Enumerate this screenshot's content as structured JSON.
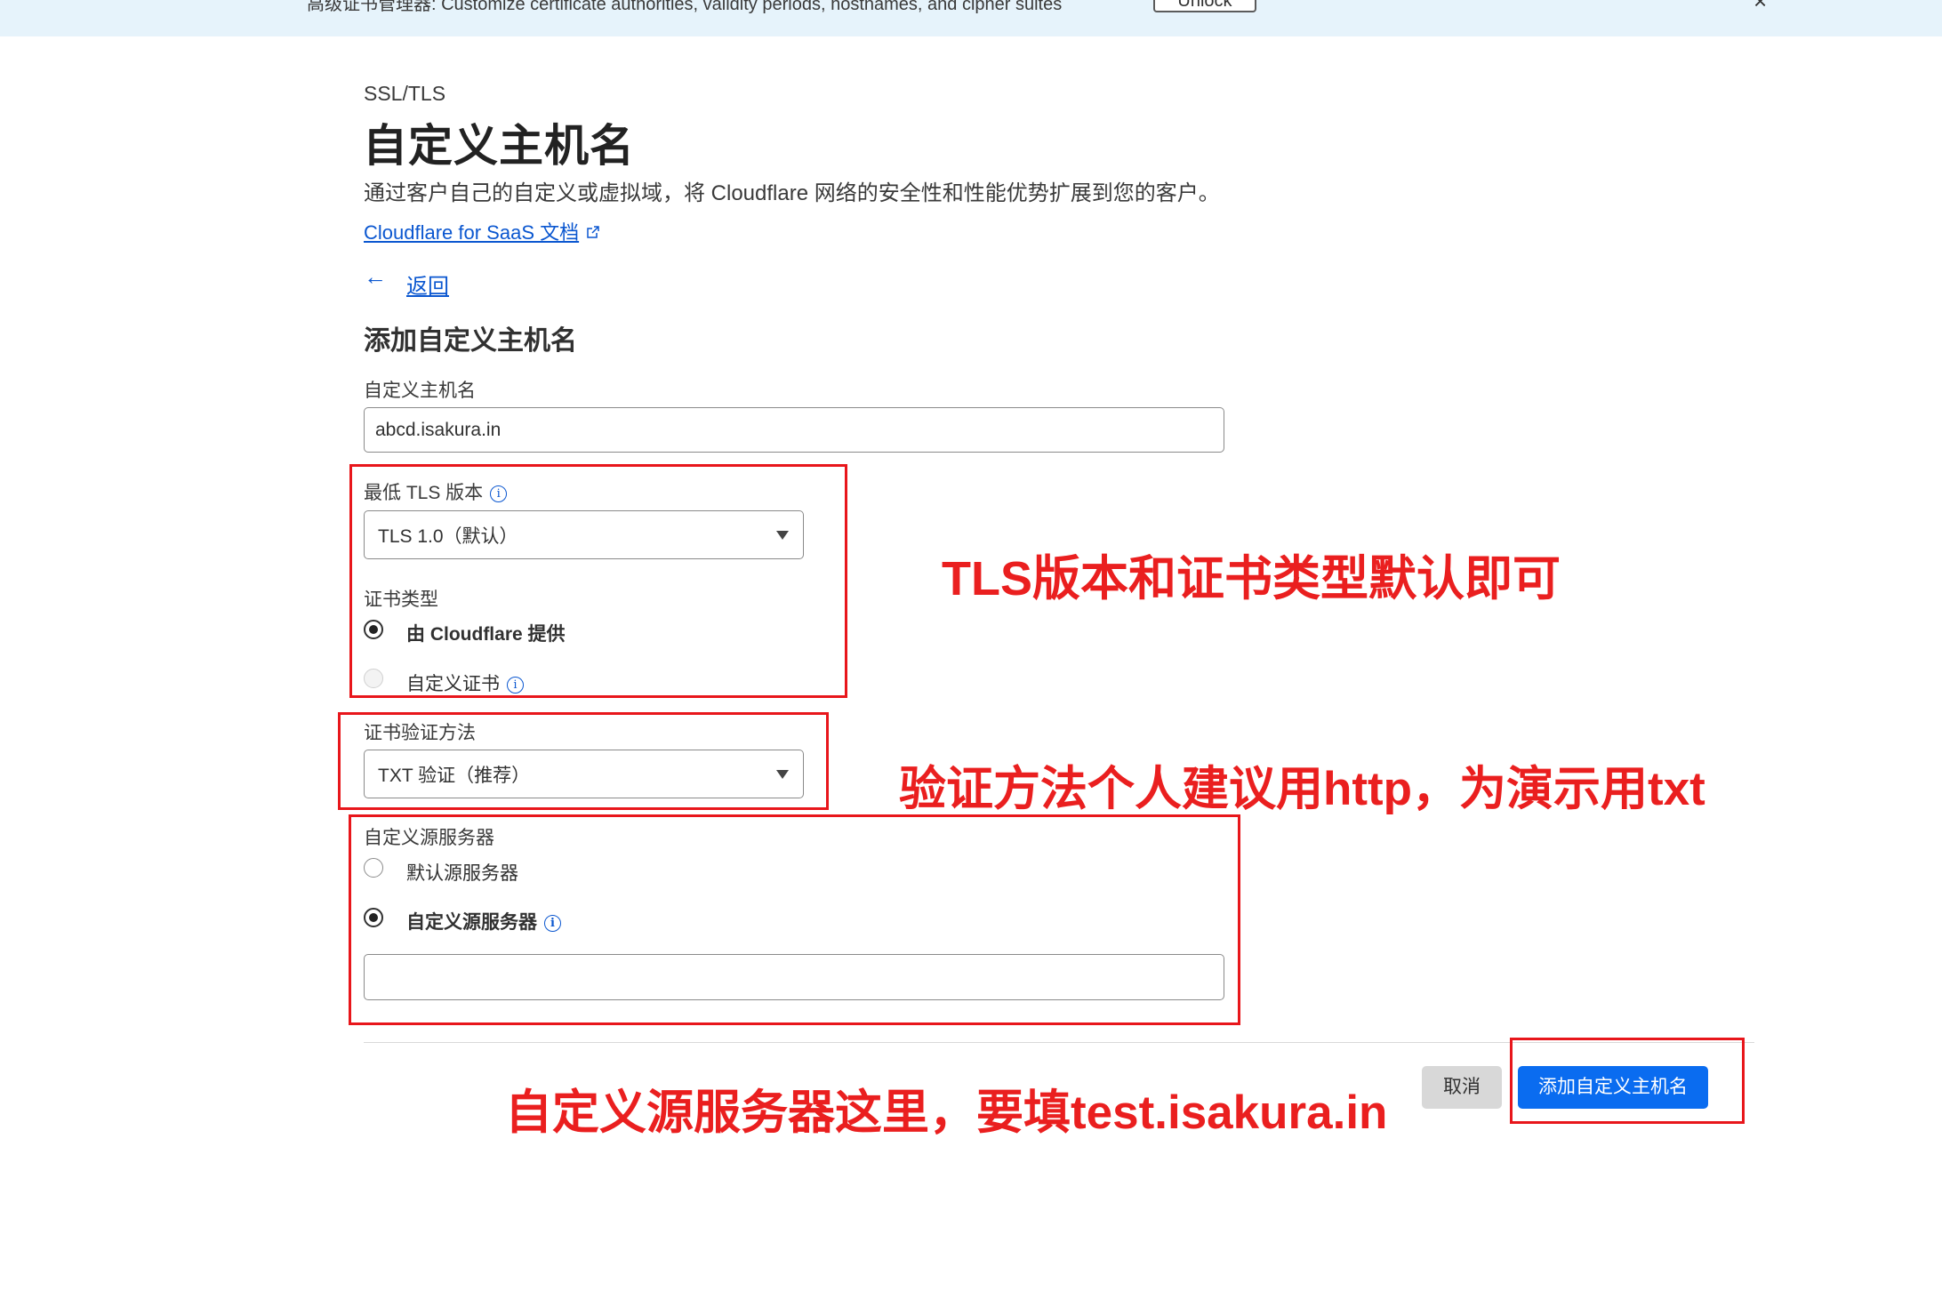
{
  "banner": {
    "text": "高级证书管理器: Customize certificate authorities, validity periods, hostnames, and cipher suites",
    "button": "Unlock",
    "close": "×"
  },
  "header": {
    "breadcrumb": "SSL/TLS",
    "title": "自定义主机名",
    "description": "通过客户自己的自定义或虚拟域，将 Cloudflare 网络的安全性和性能优势扩展到您的客户。",
    "doc_link": "Cloudflare for SaaS 文档"
  },
  "nav": {
    "back_arrow": "←",
    "back_label": "返回"
  },
  "form": {
    "section_title": "添加自定义主机名",
    "hostname": {
      "label": "自定义主机名",
      "value": "abcd.isakura.in"
    },
    "min_tls": {
      "label": "最低 TLS 版本",
      "value": "TLS 1.0（默认）"
    },
    "cert_type": {
      "label": "证书类型",
      "options": [
        "由 Cloudflare 提供",
        "自定义证书"
      ],
      "selected": "由 Cloudflare 提供"
    },
    "validation": {
      "label": "证书验证方法",
      "value": "TXT 验证（推荐）"
    },
    "origin": {
      "label": "自定义源服务器",
      "options": [
        "默认源服务器",
        "自定义源服务器"
      ],
      "selected": "自定义源服务器",
      "value": ""
    },
    "cancel": "取消",
    "submit": "添加自定义主机名"
  },
  "annotations": {
    "tls_note": "TLS版本和证书类型默认即可",
    "validation_note": "验证方法个人建议用http，为演示用txt",
    "origin_note": "自定义源服务器这里，要填test.isakura.in"
  },
  "colors": {
    "accent": "#0a6cf0",
    "link": "#0b57d0",
    "annotation_red": "#e8161b",
    "banner_bg": "#e6f3fb"
  },
  "icons": [
    "external-link-icon",
    "back-arrow-icon",
    "info-icon",
    "chevron-down-icon",
    "close-icon"
  ]
}
